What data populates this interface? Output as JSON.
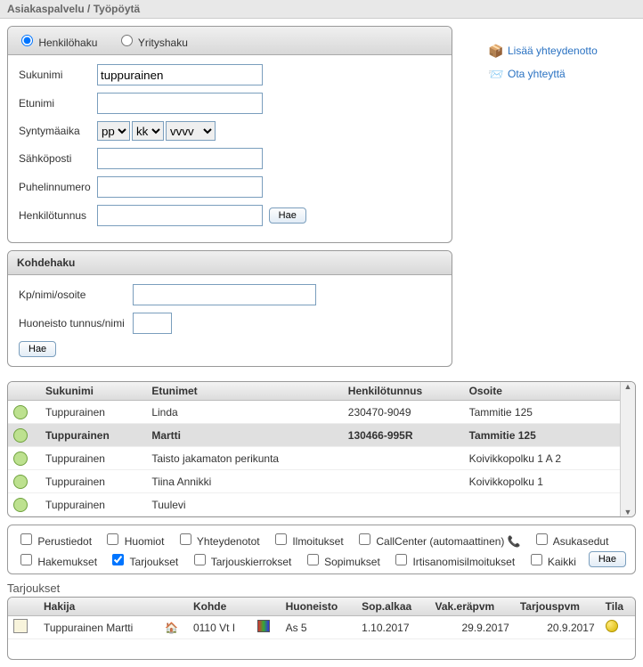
{
  "breadcrumb": "Asiakaspalvelu / Työpöytä",
  "search": {
    "radio_person": "Henkilöhaku",
    "radio_company": "Yrityshaku",
    "labels": {
      "sukunimi": "Sukunimi",
      "etunimi": "Etunimi",
      "syntymaika": "Syntymäaika",
      "sahkoposti": "Sähköposti",
      "puhelinnumero": "Puhelinnumero",
      "henkilotunnus": "Henkilötunnus"
    },
    "values": {
      "sukunimi": "tuppurainen",
      "etunimi": "",
      "sahkoposti": "",
      "puhelinnumero": "",
      "henkilotunnus": ""
    },
    "birth": {
      "pp": "pp",
      "kk": "kk",
      "vvv": "vvvv"
    },
    "hae_btn": "Hae"
  },
  "kohdehaku": {
    "title": "Kohdehaku",
    "kp_label": "Kp/nimi/osoite",
    "kp_value": "",
    "huoneisto_label": "Huoneisto tunnus/nimi",
    "huoneisto_value": "",
    "hae_btn": "Hae"
  },
  "sidebar": {
    "add_contact": "Lisää yhteydenotto",
    "contact_us": "Ota yhteyttä"
  },
  "results": {
    "headers": {
      "sukunimi": "Sukunimi",
      "etunimet": "Etunimet",
      "hetu": "Henkilötunnus",
      "osoite": "Osoite"
    },
    "rows": [
      {
        "sukunimi": "Tuppurainen",
        "etunimet": "Linda",
        "hetu": "230470-9049",
        "osoite": "Tammitie 125",
        "selected": false
      },
      {
        "sukunimi": "Tuppurainen",
        "etunimet": "Martti",
        "hetu": "130466-995R",
        "osoite": "Tammitie 125",
        "selected": true
      },
      {
        "sukunimi": "Tuppurainen",
        "etunimet": "Taisto jakamaton perikunta",
        "hetu": "",
        "osoite": "Koivikkopolku 1 A 2",
        "selected": false
      },
      {
        "sukunimi": "Tuppurainen",
        "etunimet": "Tiina Annikki",
        "hetu": "",
        "osoite": "Koivikkopolku 1",
        "selected": false
      },
      {
        "sukunimi": "Tuppurainen",
        "etunimet": "Tuulevi",
        "hetu": "",
        "osoite": "",
        "selected": false
      }
    ]
  },
  "filters": {
    "perustiedot": "Perustiedot",
    "huomiot": "Huomiot",
    "yhteydenotot": "Yhteydenotot",
    "ilmoitukset": "Ilmoitukset",
    "callcenter": "CallCenter (automaattinen)",
    "asukasedut": "Asukasedut",
    "hakemukset": "Hakemukset",
    "tarjoukset": "Tarjoukset",
    "tarjouskierrokset": "Tarjouskierrokset",
    "sopimukset": "Sopimukset",
    "irtisanomisilmoitukset": "Irtisanomisilmoitukset",
    "kaikki": "Kaikki",
    "hae_btn": "Hae",
    "checked": {
      "tarjoukset": true
    }
  },
  "offers": {
    "title": "Tarjoukset",
    "headers": {
      "hakija": "Hakija",
      "kohde": "Kohde",
      "huoneisto": "Huoneisto",
      "sopalkaa": "Sop.alkaa",
      "vakera": "Vak.eräpvm",
      "tarjouspvm": "Tarjouspvm",
      "tila": "Tila"
    },
    "rows": [
      {
        "hakija": "Tuppurainen Martti",
        "kohde": "0110 Vt I",
        "huoneisto": "As 5",
        "sopalkaa": "1.10.2017",
        "vakera": "29.9.2017",
        "tarjouspvm": "20.9.2017"
      }
    ]
  }
}
